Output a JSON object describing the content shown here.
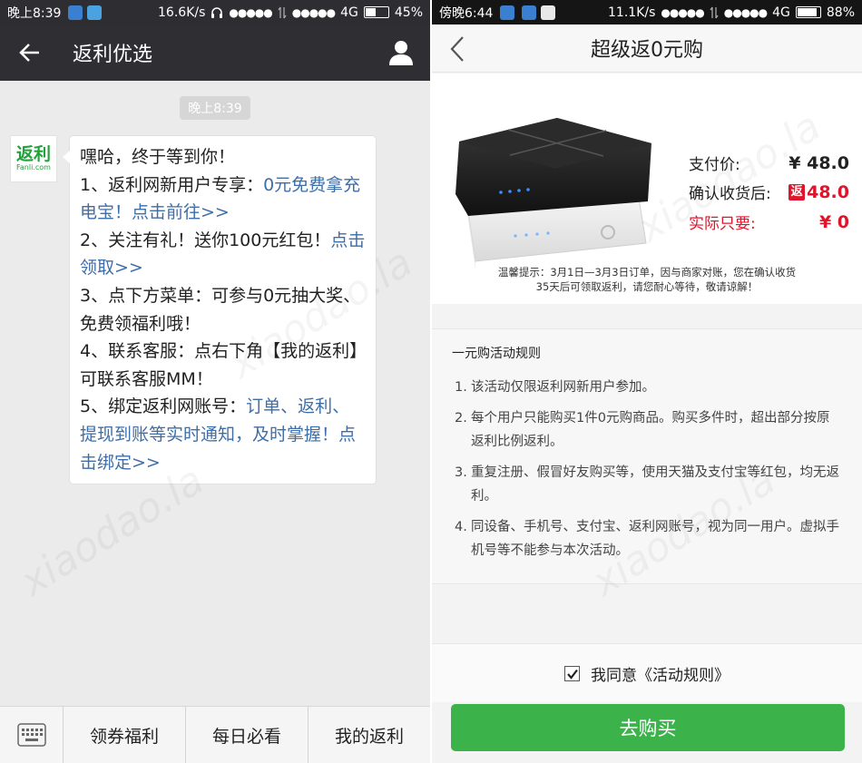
{
  "left": {
    "status": {
      "time": "晚上8:39",
      "net_speed": "16.6K/s",
      "signal": "●●●●●",
      "network": "4G",
      "battery": "45%",
      "battery_level": 0.45
    },
    "nav": {
      "title": "返利优选"
    },
    "message_time": "晚上8:39",
    "avatar": {
      "logo": "返利",
      "domain": "Fanli.com"
    },
    "message": {
      "l1": "嘿哈，终于等到你！",
      "l2a": "1、返利网新用户专享：",
      "l2b": "0元免费拿充电宝！点击前往>>",
      "l3a": "2、关注有礼！送你100元红包！",
      "l3b": "点击领取>>",
      "l4": "3、点下方菜单：可参与0元抽大奖、免费领福利哦！",
      "l5": "4、联系客服：点右下角【我的返利】可联系客服MM！",
      "l6a": "5、绑定返利网账号：",
      "l6b": "订单、返利、提现到账等实时通知，及时掌握！点击绑定>>"
    },
    "menu": [
      "领券福利",
      "每日必看",
      "我的返利"
    ]
  },
  "right": {
    "status": {
      "time": "傍晚6:44",
      "net_speed": "11.1K/s",
      "signal": "●●●●●",
      "network": "4G",
      "battery": "88%",
      "battery_level": 0.88
    },
    "nav": {
      "title": "超级返0元购"
    },
    "prices": {
      "pay_label": "支付价:",
      "pay_value": "¥ 48.0",
      "confirm_label": "确认收货后:",
      "confirm_badge": "返",
      "confirm_value": "48.0",
      "actual_label": "实际只要:",
      "actual_value": "¥ 0"
    },
    "tip": {
      "line1": "温馨提示：3月1日—3月3日订单，因与商家对账，您在确认收货",
      "line2": "35天后可领取返利，请您耐心等待，敬请谅解！"
    },
    "rules": {
      "heading": "一元购活动规则",
      "items": [
        {
          "num": "1.",
          "text": "该活动仅限返利网新用户参加。"
        },
        {
          "num": "2.",
          "text": "每个用户只能购买1件0元购商品。购买多件时，超出部分按原返利比例返利。"
        },
        {
          "num": "3.",
          "text": "重复注册、假冒好友购买等，使用天猫及支付宝等红包，均无返利。"
        },
        {
          "num": "4.",
          "text": "同设备、手机号、支付宝、返利网账号，视为同一用户。虚拟手机号等不能参与本次活动。"
        }
      ]
    },
    "agree_text": "我同意《活动规则》",
    "agree_checked": true,
    "buy_label": "去购买"
  },
  "watermark": "xiaodao.la",
  "colors": {
    "green_button": "#3cb34a",
    "red_price": "#e0142a",
    "link_blue": "#3e6ea8",
    "dark_nav": "#2f2f33"
  }
}
